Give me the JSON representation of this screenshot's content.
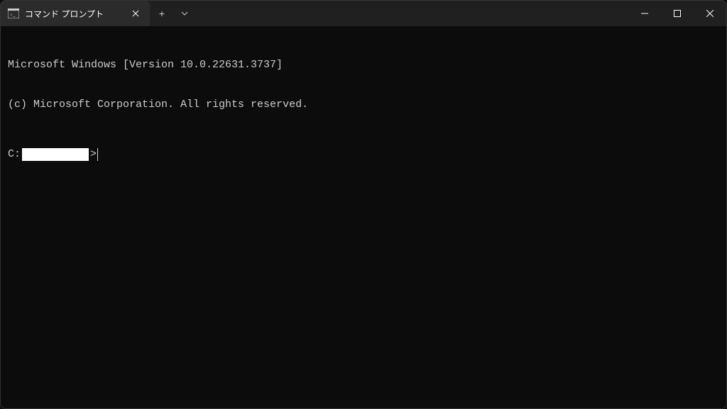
{
  "titlebar": {
    "tab_title": "コマンド プロンプト",
    "new_tab_label": "+",
    "dropdown_label": "˅"
  },
  "terminal": {
    "line1": "Microsoft Windows [Version 10.0.22631.3737]",
    "line2": "(c) Microsoft Corporation. All rights reserved.",
    "prompt_prefix": "C:",
    "prompt_suffix": ">"
  }
}
